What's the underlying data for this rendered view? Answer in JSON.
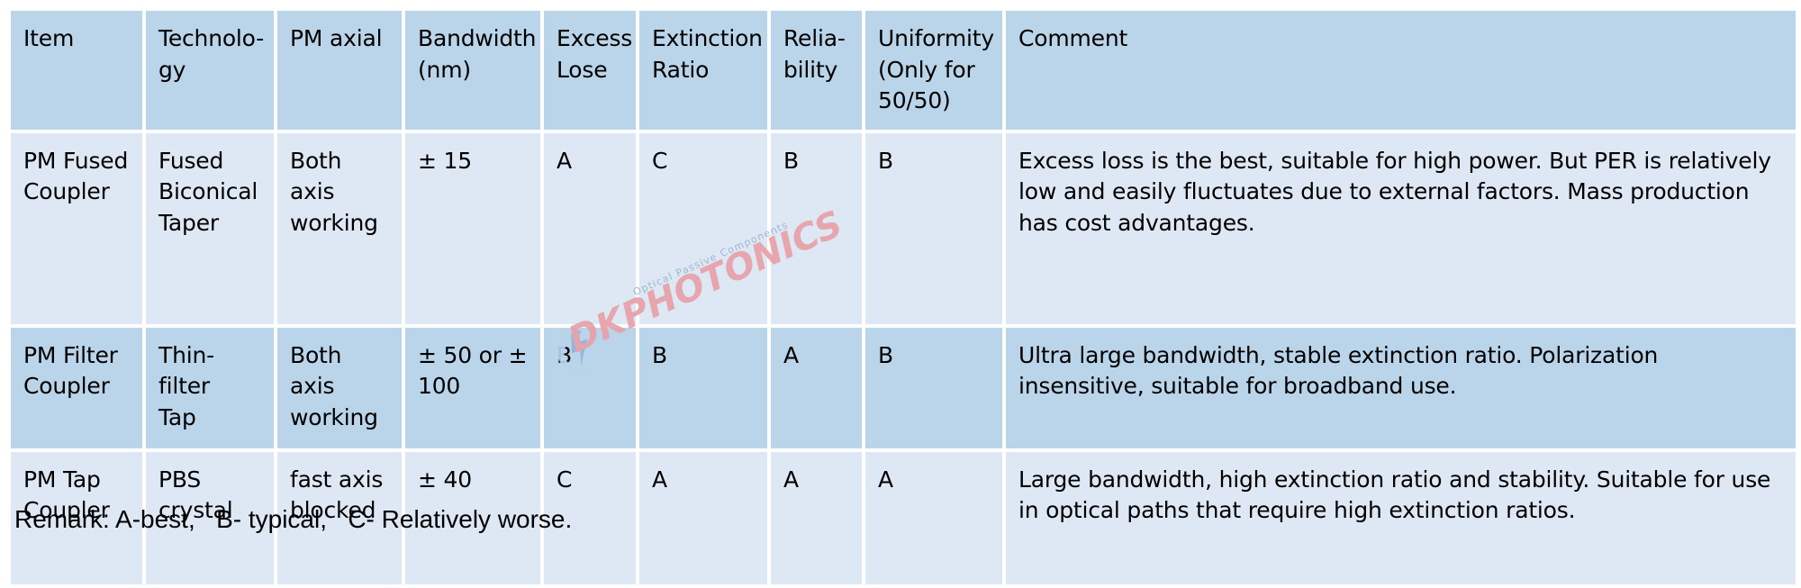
{
  "table": {
    "columns": [
      {
        "key": "item",
        "label": "Item"
      },
      {
        "key": "technology",
        "label": "Technolo-\ngy"
      },
      {
        "key": "pm_axial",
        "label": "PM axial"
      },
      {
        "key": "bandwidth",
        "label": "Bandwidth\n(nm)"
      },
      {
        "key": "excess",
        "label": "Excess\nLose"
      },
      {
        "key": "extinction",
        "label": "Extinction\nRatio"
      },
      {
        "key": "reliability",
        "label": "Relia-\nbility"
      },
      {
        "key": "uniformity",
        "label": "Uniformity\n(Only for\n50/50)"
      },
      {
        "key": "comment",
        "label": "Comment"
      }
    ],
    "rows": [
      {
        "item": "PM Fused\nCoupler",
        "technology": "Fused\nBiconical\nTaper",
        "pm_axial": "Both axis\nworking",
        "bandwidth": "± 15",
        "excess": "A",
        "extinction": "C",
        "reliability": "B",
        "uniformity": "B",
        "comment": "Excess loss is the best, suitable for high power. But PER is relatively low and easily fluctuates due to external factors. Mass production has cost advantages."
      },
      {
        "item": "PM Filter\nCoupler",
        "technology": "Thin-filter\nTap",
        "pm_axial": "Both axis\nworking",
        "bandwidth": "± 50 or ±\n100",
        "excess": "B",
        "extinction": "B",
        "reliability": "A",
        "uniformity": "B",
        "comment": "Ultra large bandwidth, stable extinction ratio. Polarization insensitive, suitable for broadband use."
      },
      {
        "item": "PM Tap\nCoupler",
        "technology": "PBS crystal",
        "pm_axial": "fast axis\nblocked",
        "bandwidth": "± 40",
        "excess": "C",
        "extinction": "A",
        "reliability": "A",
        "uniformity": "A",
        "comment": "Large bandwidth, high extinction ratio and stability. Suitable for use in optical paths that require high extinction ratios."
      }
    ]
  },
  "remark": "Remark: A-best,   B- typical,   C- Relatively worse.",
  "watermark": {
    "brand_prefix": "DK",
    "brand_suffix": "PHOTONICS",
    "tagline": "Optical Passive Components",
    "icon": "swoosh-icon"
  },
  "colors": {
    "header_fill": "#bad4ea",
    "row_light_fill": "#dde8f4",
    "row_dark_fill": "#bad4ea",
    "text": "#000000",
    "watermark_brand": "#e8a0a8",
    "watermark_tagline": "#9ab2cc",
    "page_background": "#ffffff"
  }
}
